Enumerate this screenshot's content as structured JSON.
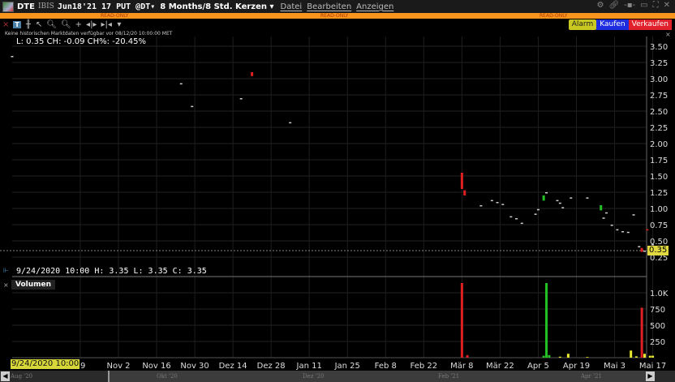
{
  "title": {
    "symbol": "DTE",
    "exchange": "IBIS",
    "contract": "Jun18'21 17 PUT @DT▾",
    "period": "8 Months/8 Std. Kerzen ▾",
    "menus": [
      "Datei",
      "Bearbeiten",
      "Anzeigen"
    ]
  },
  "readonly_label": "READ-ONLY",
  "buttons": {
    "alarm": "Alarm",
    "buy": "Kaufen",
    "sell": "Verkaufen"
  },
  "notice": "Keine historischen Marktdaten verfügbar vor 08/12/20 10:00:00 MET",
  "info_top": "L: 0.35 CH: -0.09 CH%: -20.45%",
  "info_bottom": "9/24/2020 10:00 H: 3.35 L: 3.35 C: 3.35",
  "volume_label": "Volumen",
  "last_price": "0.35",
  "cursor_date": "9/24/2020 10:00",
  "scrollbar_months": [
    "Aug '20",
    "Okt '20",
    "Dez '20",
    "Feb '21",
    "Apr '21"
  ],
  "colors": {
    "up": "#22c022",
    "down": "#e02020",
    "flat": "#cccccc",
    "volume_flat": "#e8e830",
    "readonly_bar": "#f7941d"
  },
  "chart_data": {
    "type": "candlestick",
    "price_axis": {
      "ticks": [
        3.5,
        3.25,
        3.0,
        2.75,
        2.5,
        2.25,
        2.0,
        1.75,
        1.5,
        1.25,
        1.0,
        0.75,
        0.5,
        0.25
      ],
      "labels": [
        "3.50",
        "3.25",
        "3.00",
        "2.75",
        "2.50",
        "2.25",
        "2.00",
        "1.75",
        "1.50",
        "1.25",
        "1.00",
        "0.75",
        "0.50",
        "0.25"
      ]
    },
    "volume_axis": {
      "ticks": [
        1000,
        750,
        500,
        250
      ],
      "labels": [
        "1.0K",
        "750",
        "500",
        "250"
      ]
    },
    "x_ticks": [
      {
        "date": "2020-10-19",
        "label": "19"
      },
      {
        "date": "2020-11-02",
        "label": "Nov 2"
      },
      {
        "date": "2020-11-16",
        "label": "Nov 16"
      },
      {
        "date": "2020-11-30",
        "label": "Nov 30"
      },
      {
        "date": "2020-12-14",
        "label": "Dez 14"
      },
      {
        "date": "2020-12-28",
        "label": "Dez 28"
      },
      {
        "date": "2021-01-11",
        "label": "Jan 11"
      },
      {
        "date": "2021-01-25",
        "label": "Jan 25"
      },
      {
        "date": "2021-02-08",
        "label": "Feb 8"
      },
      {
        "date": "2021-02-22",
        "label": "Feb 22"
      },
      {
        "date": "2021-03-08",
        "label": "Mär 8"
      },
      {
        "date": "2021-03-22",
        "label": "Mär 22"
      },
      {
        "date": "2021-04-05",
        "label": "Apr 5"
      },
      {
        "date": "2021-04-19",
        "label": "Apr 19"
      },
      {
        "date": "2021-05-03",
        "label": "Mai 3"
      },
      {
        "date": "2021-05-17",
        "label": "Mai 17"
      }
    ],
    "candles": [
      {
        "date": "2020-09-24",
        "o": 3.35,
        "c": 3.35
      },
      {
        "date": "2020-11-25",
        "o": 2.93,
        "c": 2.93
      },
      {
        "date": "2020-11-29",
        "o": 2.58,
        "c": 2.58
      },
      {
        "date": "2020-12-17",
        "o": 2.7,
        "c": 2.7
      },
      {
        "date": "2020-12-21",
        "o": 3.1,
        "c": 3.04
      },
      {
        "date": "2021-01-04",
        "o": 2.33,
        "c": 2.33
      },
      {
        "date": "2021-03-08",
        "o": 1.55,
        "c": 1.3
      },
      {
        "date": "2021-03-09",
        "o": 1.28,
        "c": 1.2
      },
      {
        "date": "2021-03-15",
        "o": 1.05,
        "c": 1.05
      },
      {
        "date": "2021-03-19",
        "o": 1.13,
        "c": 1.13
      },
      {
        "date": "2021-03-21",
        "o": 1.1,
        "c": 1.1
      },
      {
        "date": "2021-03-23",
        "o": 1.07,
        "c": 1.07
      },
      {
        "date": "2021-03-26",
        "o": 0.88,
        "c": 0.88
      },
      {
        "date": "2021-03-28",
        "o": 0.85,
        "c": 0.85
      },
      {
        "date": "2021-03-30",
        "o": 0.78,
        "c": 0.78
      },
      {
        "date": "2021-04-04",
        "o": 0.92,
        "c": 0.92
      },
      {
        "date": "2021-04-05",
        "o": 0.99,
        "c": 0.99
      },
      {
        "date": "2021-04-07",
        "o": 1.12,
        "c": 1.2
      },
      {
        "date": "2021-04-08",
        "o": 1.25,
        "c": 1.25
      },
      {
        "date": "2021-04-12",
        "o": 1.13,
        "c": 1.13
      },
      {
        "date": "2021-04-13",
        "o": 1.09,
        "c": 1.09
      },
      {
        "date": "2021-04-14",
        "o": 1.02,
        "c": 1.02
      },
      {
        "date": "2021-04-17",
        "o": 1.17,
        "c": 1.17
      },
      {
        "date": "2021-04-23",
        "o": 1.17,
        "c": 1.17
      },
      {
        "date": "2021-04-28",
        "o": 0.97,
        "c": 1.05
      },
      {
        "date": "2021-04-29",
        "o": 0.86,
        "c": 0.86
      },
      {
        "date": "2021-04-30",
        "o": 0.94,
        "c": 0.94
      },
      {
        "date": "2021-05-02",
        "o": 0.75,
        "c": 0.75
      },
      {
        "date": "2021-05-04",
        "o": 0.68,
        "c": 0.68
      },
      {
        "date": "2021-05-06",
        "o": 0.65,
        "c": 0.65
      },
      {
        "date": "2021-05-08",
        "o": 0.64,
        "c": 0.64
      },
      {
        "date": "2021-05-10",
        "o": 0.91,
        "c": 0.91
      },
      {
        "date": "2021-05-12",
        "o": 0.42,
        "c": 0.42
      },
      {
        "date": "2021-05-13",
        "o": 0.39,
        "c": 0.33
      },
      {
        "date": "2021-05-14",
        "o": 0.35,
        "c": 0.35
      },
      {
        "date": "2021-05-15",
        "o": 0.68,
        "c": 0.67
      },
      {
        "date": "2021-05-17",
        "o": 0.45,
        "c": 0.45
      }
    ],
    "volume": [
      {
        "date": "2021-03-08",
        "v": 1150,
        "dir": "down"
      },
      {
        "date": "2021-03-10",
        "v": 40,
        "dir": "down"
      },
      {
        "date": "2021-04-07",
        "v": 30,
        "dir": "up"
      },
      {
        "date": "2021-04-08",
        "v": 1150,
        "dir": "up"
      },
      {
        "date": "2021-04-09",
        "v": 40,
        "dir": "up"
      },
      {
        "date": "2021-04-13",
        "v": 15,
        "dir": "flat"
      },
      {
        "date": "2021-04-16",
        "v": 60,
        "dir": "flat"
      },
      {
        "date": "2021-04-23",
        "v": 10,
        "dir": "flat"
      },
      {
        "date": "2021-05-09",
        "v": 110,
        "dir": "flat"
      },
      {
        "date": "2021-05-11",
        "v": 20,
        "dir": "flat"
      },
      {
        "date": "2021-05-13",
        "v": 770,
        "dir": "down"
      },
      {
        "date": "2021-05-14",
        "v": 60,
        "dir": "flat"
      },
      {
        "date": "2021-05-16",
        "v": 30,
        "dir": "flat"
      },
      {
        "date": "2021-05-17",
        "v": 30,
        "dir": "flat"
      }
    ]
  }
}
